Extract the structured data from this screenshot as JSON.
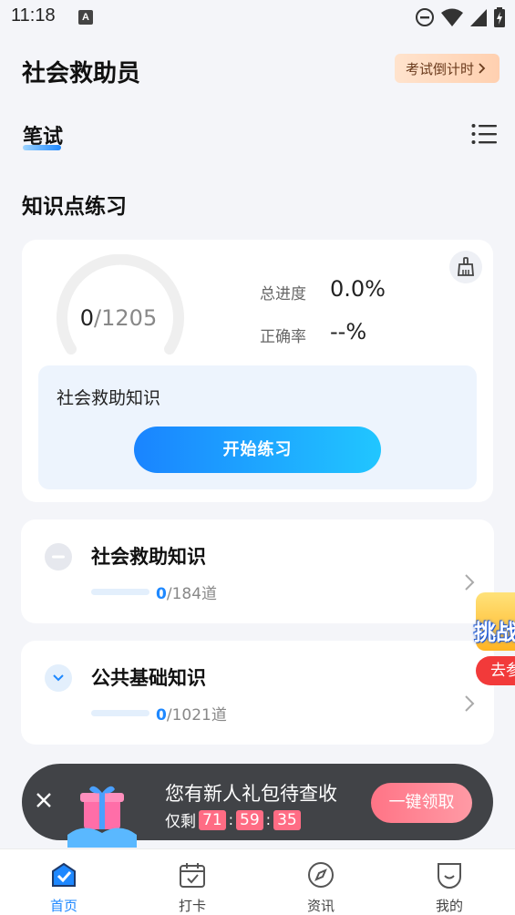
{
  "status_bar": {
    "time": "11:18",
    "a_icon": "A"
  },
  "header": {
    "title": "社会救助员",
    "countdown_label": "考试倒计时"
  },
  "tabs": {
    "written": "笔试"
  },
  "section": {
    "title": "知识点练习"
  },
  "progress": {
    "done": "0",
    "total": "/1205",
    "overall_label": "总进度",
    "overall_value": "0.0%",
    "accuracy_label": "正确率",
    "accuracy_value": "--%",
    "current_topic": "社会救助知识",
    "start_button": "开始练习"
  },
  "topics": [
    {
      "title": "社会救助知识",
      "done": "0",
      "total": "/184道",
      "state": "collapsed"
    },
    {
      "title": "公共基础知识",
      "done": "0",
      "total": "/1021道",
      "state": "expandable"
    }
  ],
  "floating_badge": {
    "text": "挑战",
    "button": "去参"
  },
  "promo": {
    "title": "您有新人礼包待查收",
    "remaining_label": "仅剩",
    "hours": "71",
    "minutes": "59",
    "seconds": "35",
    "claim_button": "一键领取"
  },
  "bottom_nav": [
    {
      "label": "首页",
      "icon": "home-icon",
      "active": true
    },
    {
      "label": "打卡",
      "icon": "calendar-check-icon",
      "active": false
    },
    {
      "label": "资讯",
      "icon": "compass-icon",
      "active": false
    },
    {
      "label": "我的",
      "icon": "profile-icon",
      "active": false
    }
  ],
  "colors": {
    "accent": "#1e88ff",
    "background": "#f4f5f9",
    "promo_bg": "#414347",
    "timer_box": "#ff6c84"
  }
}
